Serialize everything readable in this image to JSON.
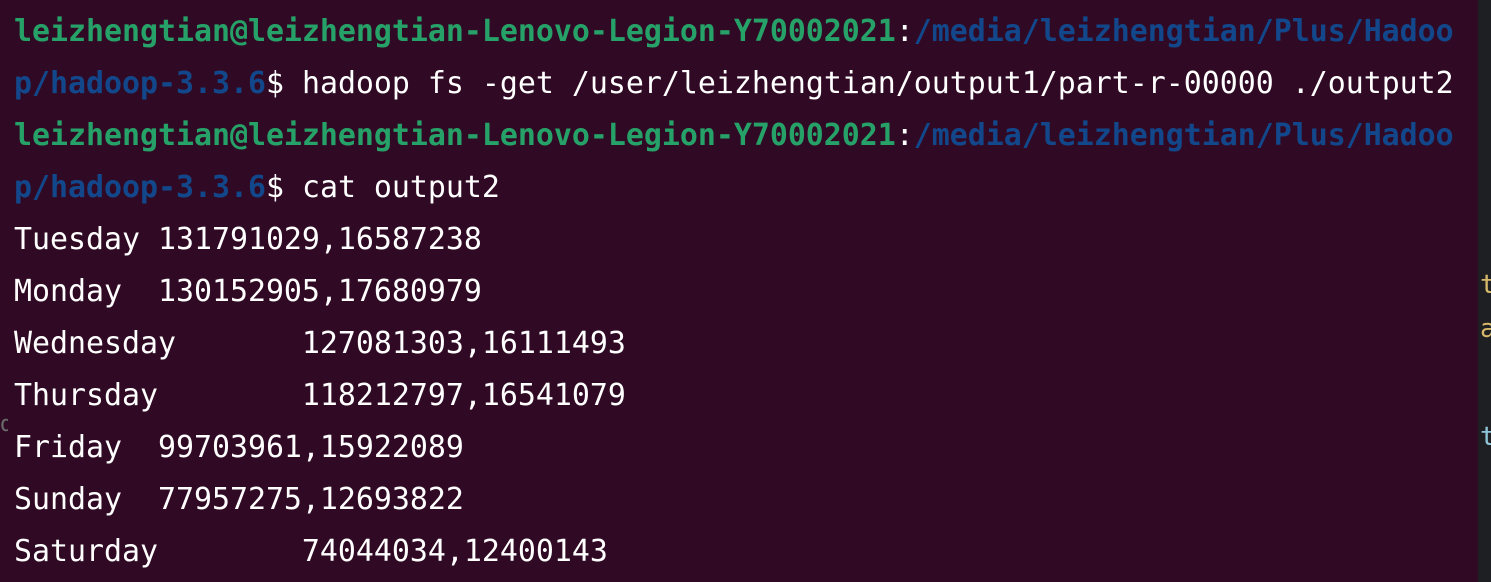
{
  "terminal": {
    "prompt_user": "leizhengtian@leizhengtian-Lenovo-Legion-Y70002021",
    "prompt_sep": ":",
    "path_part1": "/media/leizhengtian/Plus/Hadoo",
    "path_part2": "p/hadoop-3.3.6",
    "prompt_symbol": "$",
    "command1": " hadoop fs -get /user/leizhengtian/output1/part-r-00000 ./output2",
    "command2": " cat output2",
    "output_lines": [
      "Tuesday 131791029,16587238",
      "Monday  130152905,17680979",
      "Wednesday       127081303,16111493",
      "Thursday        118212797,16541079",
      "Friday  99703961,15922089",
      "Sunday  77957275,12693822",
      "Saturday        74044034,12400143"
    ]
  },
  "edge": {
    "right_chars": [
      "t",
      "a",
      "t"
    ],
    "left_char": "d"
  },
  "colors": {
    "background": "#300a24",
    "user": "#26a269",
    "path": "#12488b",
    "text": "#ffffff"
  }
}
